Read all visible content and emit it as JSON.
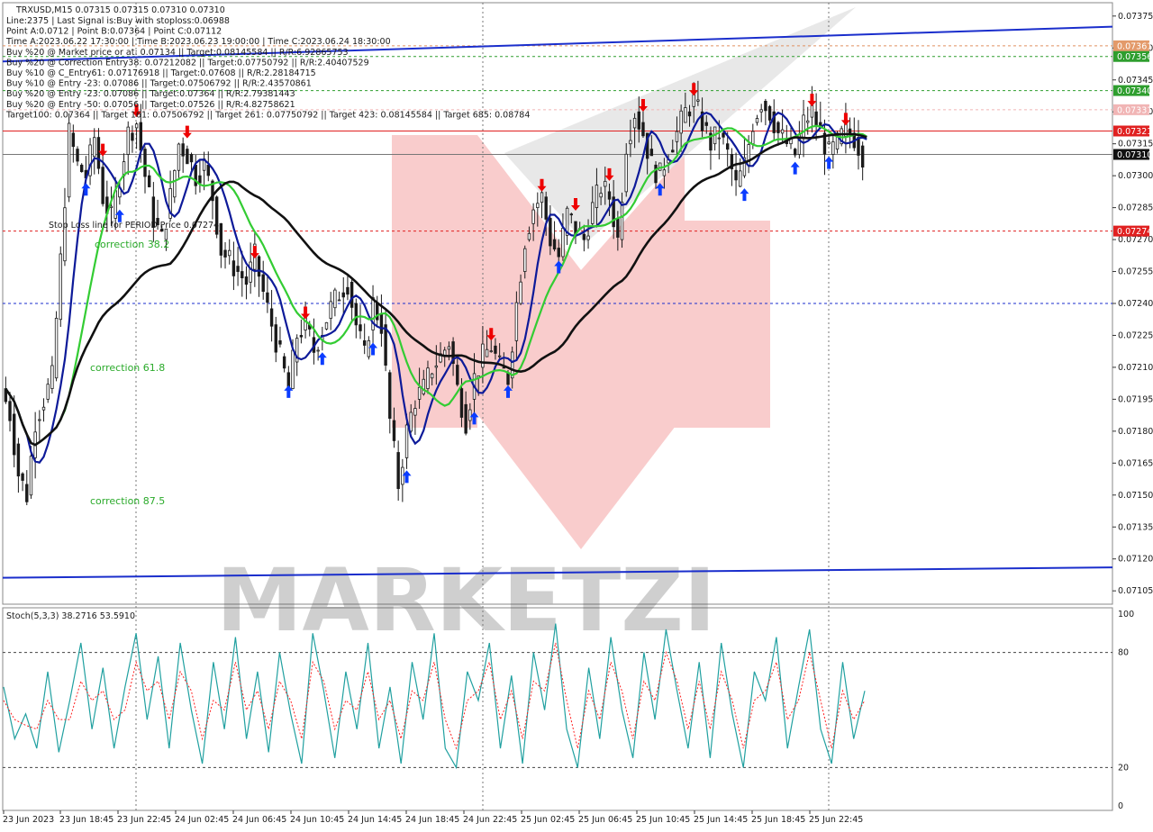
{
  "header": {
    "symbol_line": "TRXUSD,M15  0.07315 0.07315 0.07310 0.07310",
    "info_lines": [
      "Line:2375 | Last Signal is:Buy with stoploss:0.06988",
      "Point A:0.0712 | Point B:0.07364 | Point C:0.07112",
      "Time A:2023.06.22 17:30:00 | Time B:2023.06.23 19:00:00 | Time C:2023.06.24 18:30:00",
      "Buy %20 @ Market price or at: 0.07134 || Target:0.08145584 || R/R:6.92865753",
      "Buy %20 @ Correction Entry38: 0.07212082 || Target:0.07750792 || R/R:2.40407529",
      "Buy %10 @ C_Entry61: 0.07176918 || Target:0.07608 || R/R:2.28184715",
      "Buy %10 @ Entry -23: 0.07086 || Target:0.07506792 || R/R:2.43570861",
      "Buy %20 @ Entry -23: 0.07086 || Target:0.07364 || R/R:2.79381443",
      "Buy %20 @ Entry -50: 0.07056 || Target:0.07526 || R/R:4.82758621",
      "Target100: 0.07364 || Target 161: 0.07506792 || Target 261: 0.07750792 || Target 423: 0.08145584 || Target 685: 0.08784"
    ]
  },
  "labels": {
    "stop_loss": "Stop Loss line for PERIOD Price 0.07274",
    "correction_38": "correction 38.2",
    "correction_61": "correction 61.8",
    "correction_87": "correction 87.5",
    "watermark": "MARKETZI"
  },
  "stoch": {
    "title": "Stoch(5,3,3) 38.2716 53.5910",
    "levels": [
      "100",
      "80",
      "20",
      "0"
    ]
  },
  "colors": {
    "candle": "#1a1a1a",
    "ma_fast": "#0d1a99",
    "ma_mid": "#33cc33",
    "ma_slow": "#111111",
    "channel": "#1a2ecc",
    "red_line": "#ff0000",
    "stoch_main": "#20a0a0",
    "stoch_signal": "#ff2020",
    "up_arrow": "#0b3cff",
    "down_arrow": "#ee0000"
  },
  "chart_data": {
    "type": "candlestick",
    "instrument": "TRXUSD",
    "timeframe": "M15",
    "ylim": [
      0.071,
      0.0738
    ],
    "y_ticks": [
      "0.07375",
      "0.07360",
      "0.07345",
      "0.07330",
      "0.07315",
      "0.07300",
      "0.07285",
      "0.07270",
      "0.07255",
      "0.07240",
      "0.07225",
      "0.07210",
      "0.07195",
      "0.07180",
      "0.07165",
      "0.07150",
      "0.07135",
      "0.07120",
      "0.07105"
    ],
    "x_ticks": [
      "23 Jun 2023",
      "23 Jun 18:45",
      "23 Jun 22:45",
      "24 Jun 02:45",
      "24 Jun 06:45",
      "24 Jun 10:45",
      "24 Jun 14:45",
      "24 Jun 18:45",
      "24 Jun 22:45",
      "25 Jun 02:45",
      "25 Jun 06:45",
      "25 Jun 10:45",
      "25 Jun 14:45",
      "25 Jun 18:45",
      "25 Jun 22:45"
    ],
    "price_labels": [
      {
        "value": 0.07361,
        "text": "0.07361",
        "bg": "#e39a6a"
      },
      {
        "value": 0.07356,
        "text": "0.07356",
        "bg": "#2e9e2e"
      },
      {
        "value": 0.0734,
        "text": "0.07340",
        "bg": "#2e9e2e"
      },
      {
        "value": 0.07331,
        "text": "0.07331",
        "bg": "#f1b5b5"
      },
      {
        "value": 0.07321,
        "text": "0.07321",
        "bg": "#e02020"
      },
      {
        "value": 0.0731,
        "text": "0.07310",
        "bg": "#111111"
      },
      {
        "value": 0.07274,
        "text": "0.07274",
        "bg": "#e02020"
      }
    ],
    "horizontal_lines": [
      {
        "value": 0.07361,
        "style": "dash",
        "color": "#e09060"
      },
      {
        "value": 0.07356,
        "style": "dash",
        "color": "#2e9e2e"
      },
      {
        "value": 0.0734,
        "style": "dash",
        "color": "#2e9e2e"
      },
      {
        "value": 0.07331,
        "style": "dash",
        "color": "#f1b5b5"
      },
      {
        "value": 0.07321,
        "style": "solid",
        "color": "#e02020"
      },
      {
        "value": 0.0731,
        "style": "solid",
        "color": "#777777"
      },
      {
        "value": 0.07274,
        "style": "dash",
        "color": "#e02020"
      },
      {
        "value": 0.0724,
        "style": "dash",
        "color": "#1a2ecc"
      }
    ],
    "channel_top": [
      0.07352,
      0.0737
    ],
    "channel_bottom": [
      0.07112,
      0.07116
    ],
    "close_path": [
      [
        0,
        0.072
      ],
      [
        2,
        0.07188
      ],
      [
        4,
        0.0716
      ],
      [
        6,
        0.0715
      ],
      [
        8,
        0.07185
      ],
      [
        10,
        0.07195
      ],
      [
        12,
        0.07205
      ],
      [
        14,
        0.0726
      ],
      [
        16,
        0.0732
      ],
      [
        18,
        0.07305
      ],
      [
        20,
        0.073
      ],
      [
        22,
        0.07318
      ],
      [
        24,
        0.0729
      ],
      [
        26,
        0.0728
      ],
      [
        28,
        0.073
      ],
      [
        30,
        0.0732
      ],
      [
        32,
        0.07325
      ],
      [
        34,
        0.073
      ],
      [
        36,
        0.0728
      ],
      [
        38,
        0.0727
      ],
      [
        40,
        0.0729
      ],
      [
        42,
        0.07315
      ],
      [
        44,
        0.0731
      ],
      [
        46,
        0.073
      ],
      [
        48,
        0.07305
      ],
      [
        50,
        0.0729
      ],
      [
        52,
        0.07265
      ],
      [
        54,
        0.0726
      ],
      [
        56,
        0.07255
      ],
      [
        58,
        0.0725
      ],
      [
        60,
        0.07262
      ],
      [
        62,
        0.07245
      ],
      [
        64,
        0.0723
      ],
      [
        66,
        0.07215
      ],
      [
        68,
        0.072
      ],
      [
        70,
        0.07225
      ],
      [
        72,
        0.0723
      ],
      [
        74,
        0.07218
      ],
      [
        76,
        0.07228
      ],
      [
        78,
        0.07238
      ],
      [
        80,
        0.07245
      ],
      [
        82,
        0.0725
      ],
      [
        84,
        0.0723
      ],
      [
        86,
        0.07215
      ],
      [
        88,
        0.0724
      ],
      [
        90,
        0.0723
      ],
      [
        92,
        0.07185
      ],
      [
        94,
        0.07155
      ],
      [
        96,
        0.0718
      ],
      [
        98,
        0.07195
      ],
      [
        100,
        0.072
      ],
      [
        102,
        0.0721
      ],
      [
        104,
        0.07215
      ],
      [
        106,
        0.07222
      ],
      [
        108,
        0.072
      ],
      [
        110,
        0.07185
      ],
      [
        112,
        0.07205
      ],
      [
        114,
        0.07215
      ],
      [
        116,
        0.0722
      ],
      [
        118,
        0.0721
      ],
      [
        120,
        0.07205
      ],
      [
        122,
        0.0724
      ],
      [
        124,
        0.0727
      ],
      [
        126,
        0.07285
      ],
      [
        128,
        0.0729
      ],
      [
        130,
        0.0727
      ],
      [
        132,
        0.07262
      ],
      [
        134,
        0.07282
      ],
      [
        136,
        0.07275
      ],
      [
        138,
        0.0727
      ],
      [
        140,
        0.07285
      ],
      [
        142,
        0.07295
      ],
      [
        144,
        0.0729
      ],
      [
        146,
        0.0727
      ],
      [
        148,
        0.07315
      ],
      [
        150,
        0.0733
      ],
      [
        152,
        0.0732
      ],
      [
        154,
        0.07305
      ],
      [
        156,
        0.073
      ],
      [
        158,
        0.07312
      ],
      [
        160,
        0.0732
      ],
      [
        162,
        0.0733
      ],
      [
        164,
        0.07335
      ],
      [
        166,
        0.07325
      ],
      [
        168,
        0.07315
      ],
      [
        170,
        0.0732
      ],
      [
        172,
        0.0731
      ],
      [
        174,
        0.07295
      ],
      [
        176,
        0.07305
      ],
      [
        178,
        0.07325
      ],
      [
        180,
        0.07335
      ],
      [
        182,
        0.0733
      ],
      [
        184,
        0.0732
      ],
      [
        186,
        0.07315
      ],
      [
        188,
        0.0731
      ],
      [
        190,
        0.07325
      ],
      [
        192,
        0.0733
      ],
      [
        194,
        0.0732
      ],
      [
        196,
        0.0731
      ],
      [
        198,
        0.07315
      ],
      [
        200,
        0.07322
      ],
      [
        202,
        0.07318
      ],
      [
        204,
        0.0731
      ]
    ],
    "series": [
      {
        "name": "Stoch main",
        "values": [
          62,
          35,
          48,
          30,
          70,
          28,
          55,
          85,
          40,
          72,
          30,
          62,
          90,
          45,
          78,
          30,
          85,
          50,
          22,
          75,
          40,
          88,
          35,
          70,
          28,
          80,
          48,
          22,
          90,
          60,
          25,
          70,
          40,
          85,
          30,
          62,
          22,
          75,
          45,
          90,
          30,
          20,
          70,
          55,
          85,
          30,
          68,
          22,
          80,
          50,
          95,
          40,
          20,
          72,
          35,
          88,
          50,
          25,
          80,
          45,
          92,
          60,
          30,
          75,
          25,
          85,
          48,
          20,
          70,
          55,
          88,
          30,
          62,
          92,
          40,
          22,
          75,
          35,
          60
        ]
      },
      {
        "name": "Stoch signal",
        "values": [
          55,
          45,
          42,
          40,
          55,
          45,
          45,
          65,
          55,
          60,
          45,
          50,
          75,
          60,
          65,
          45,
          70,
          60,
          35,
          55,
          50,
          75,
          50,
          60,
          40,
          65,
          55,
          35,
          75,
          65,
          40,
          55,
          50,
          70,
          45,
          55,
          35,
          60,
          55,
          75,
          45,
          30,
          55,
          60,
          75,
          45,
          60,
          35,
          65,
          60,
          85,
          55,
          30,
          60,
          45,
          75,
          60,
          35,
          65,
          55,
          80,
          65,
          40,
          65,
          40,
          70,
          55,
          30,
          55,
          60,
          75,
          45,
          55,
          80,
          55,
          30,
          60,
          45,
          55
        ]
      }
    ],
    "stoch_ylim": [
      0,
      100
    ]
  }
}
